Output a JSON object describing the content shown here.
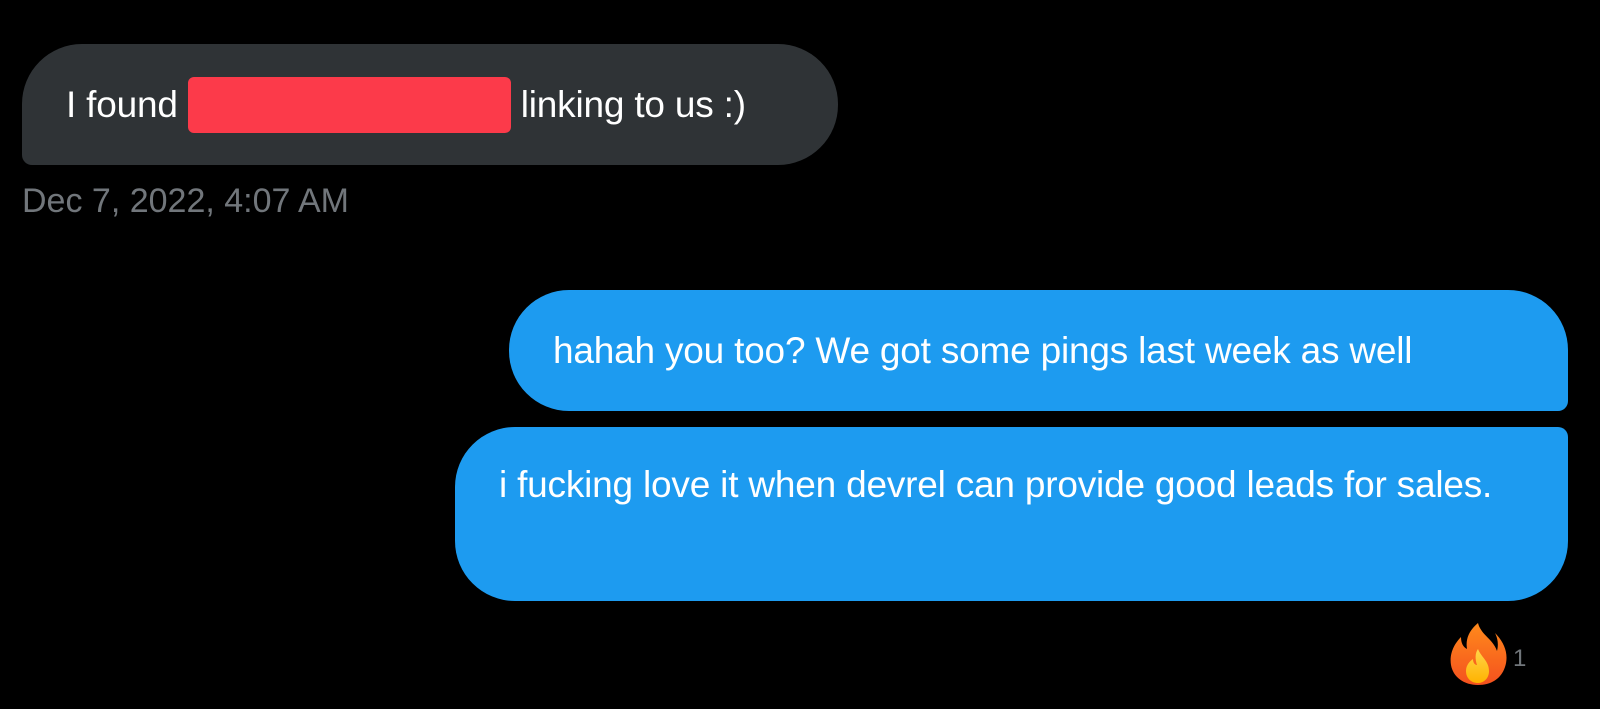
{
  "conversation": {
    "received_message": {
      "text_before": "I found",
      "redacted": true,
      "text_after": "linking to us :)",
      "timestamp": "Dec 7, 2022, 4:07 AM"
    },
    "sent_messages": [
      {
        "text": "hahah you too? We got some pings last week as well"
      },
      {
        "text": "i fucking love it when devrel can provide good leads for sales."
      }
    ],
    "reaction": {
      "icon": "fire-icon",
      "count": "1"
    }
  },
  "colors": {
    "background": "#000000",
    "received_bubble": "#2f3336",
    "sent_bubble": "#1d9bf0",
    "redaction": "#fc3a4a",
    "muted_text": "#71767b"
  }
}
